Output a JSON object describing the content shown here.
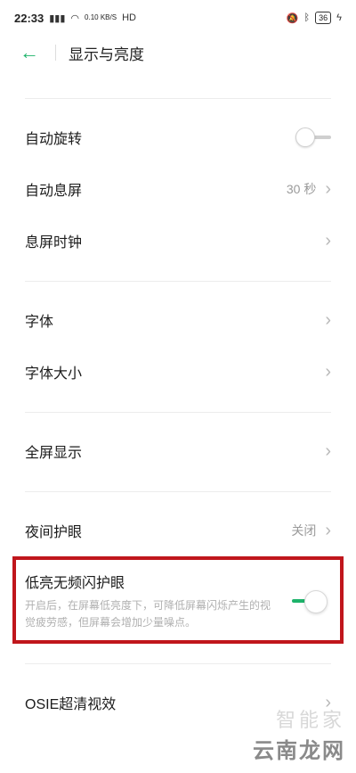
{
  "status_bar": {
    "time": "22:33",
    "signal": "4G",
    "net_speed": "0.10 KB/S",
    "hd": "HD",
    "battery": "36"
  },
  "header": {
    "back_icon": "back-arrow-icon",
    "title": "显示与亮度"
  },
  "rows": {
    "auto_rotate": "自动旋转",
    "screen_timeout": "自动息屏",
    "screen_timeout_value": "30 秒",
    "aod_clock": "息屏时钟",
    "font": "字体",
    "font_size": "字体大小",
    "fullscreen": "全屏显示",
    "night_mode": "夜间护眼",
    "night_mode_value": "关闭",
    "dc_dimming_title": "低亮无频闪护眼",
    "dc_dimming_desc": "开启后，在屏幕低亮度下，可降低屏幕闪烁产生的视觉疲劳感，但屏幕会增加少量噪点。",
    "osie": "OSIE超清视效"
  },
  "toggles": {
    "auto_rotate": false,
    "dc_dimming": true
  },
  "colors": {
    "accent": "#1db36a",
    "highlight_border": "#c0161c"
  },
  "watermark": {
    "top": "智能家",
    "bottom": "云南龙网"
  }
}
